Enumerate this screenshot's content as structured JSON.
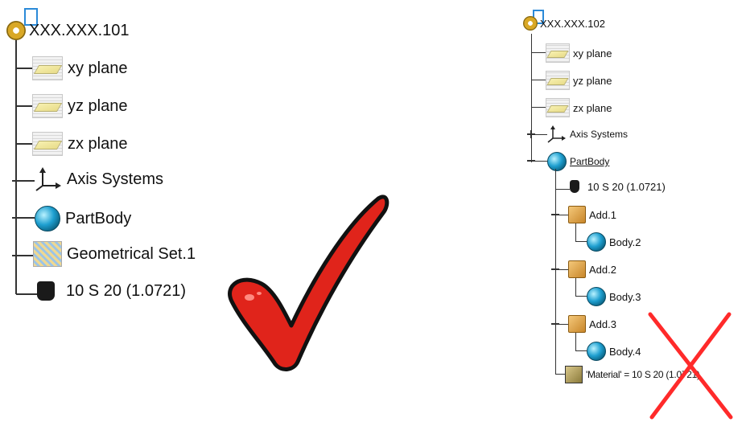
{
  "left_tree": {
    "root": "XXX.XXX.101",
    "items": [
      "xy plane",
      "yz plane",
      "zx plane",
      "Axis Systems",
      "PartBody",
      "Geometrical Set.1",
      "10 S 20 (1.0721)"
    ]
  },
  "right_tree": {
    "root": "XXX.XXX.102",
    "items": [
      "xy plane",
      "yz plane",
      "zx plane",
      "Axis Systems",
      "PartBody",
      "10 S 20 (1.0721)",
      "Add.1",
      "Body.2",
      "Add.2",
      "Body.3",
      "Add.3",
      "Body.4",
      "'Material' = 10 S 20 (1.0721)"
    ]
  },
  "marks": {
    "check_color": "#e0241b",
    "cross_color": "#ff2a2a"
  },
  "icons": [
    "document-icon",
    "gear-icon",
    "plane-icon",
    "axis-system-icon",
    "part-body-icon",
    "geometrical-set-icon",
    "material-icon",
    "add-operation-icon",
    "body-icon",
    "material-box-icon"
  ]
}
